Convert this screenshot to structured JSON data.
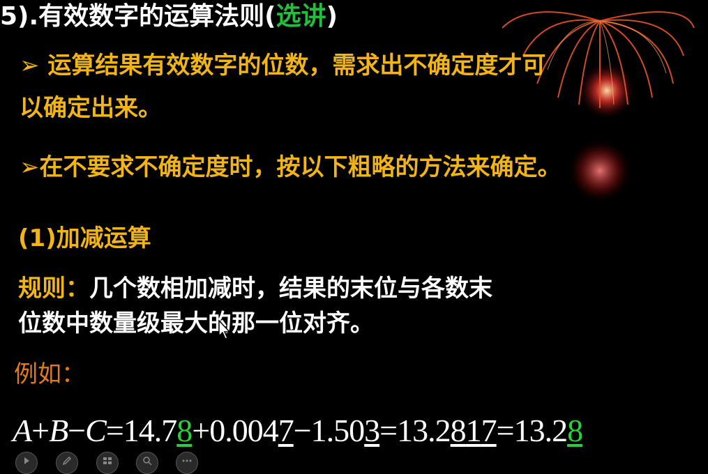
{
  "title": {
    "prefix": "5).有效数字的运算法则(",
    "highlight": "选讲",
    "suffix": ")"
  },
  "bullets": [
    {
      "marker": "➢ ",
      "line1": "运算结果有效数字的位数，需求出不确定度才可",
      "line2": "以确定出来。"
    },
    {
      "marker": "➢",
      "line1": "在不要求不确定度时，按以下粗略的方法来确定。"
    }
  ],
  "section": {
    "heading": "(1)加减运算"
  },
  "rule": {
    "label": "规则：",
    "text1": "几个数相加减时，结果的末位与各数末",
    "text2": "位数中数量级最大的那一位对齐。"
  },
  "example": {
    "label": "例如："
  },
  "formula": {
    "A": "A",
    "plus1": "+",
    "B": "B",
    "minus1": "−",
    "C": "C",
    "eq1": "=",
    "a_main": "14.7",
    "a_last": "8",
    "plus2": "+",
    "b_main": "0.004",
    "b_last": "7",
    "minus2": "−",
    "c_main": "1.50",
    "c_last": "3",
    "eq2": "=",
    "r1_main": "13.2",
    "r1_d1": "8",
    "r1_d2": "1",
    "r1_d3": "7",
    "eq3": "=",
    "r2_main": "13.2",
    "r2_last": "8"
  },
  "toolbar": {
    "buttons": [
      "play-icon",
      "pen-icon",
      "slides-icon",
      "zoom-icon",
      "more-icon"
    ]
  },
  "colors": {
    "accent_yellow": "#f2b518",
    "accent_green": "#22c03a",
    "example_orange": "#e07a1e"
  }
}
